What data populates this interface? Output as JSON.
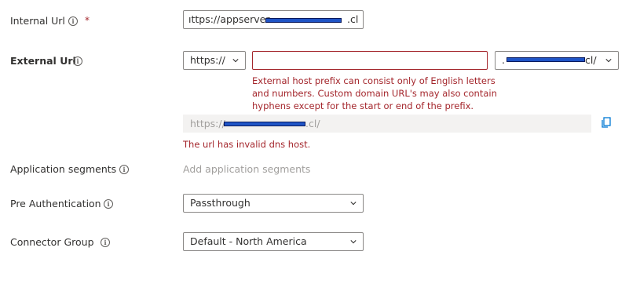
{
  "internal_url": {
    "label": "Internal Url",
    "required_marker": "*",
    "value_prefix": "ıttps://appserver",
    "value_suffix": ".cl"
  },
  "external_url": {
    "label": "External Url",
    "scheme": "https://",
    "prefix_value": "",
    "domain_prefix": ".",
    "domain_suffix": "cl/",
    "prefix_error_lines": [
      "External host prefix can consist only of English letters",
      "and numbers. Custom domain URL's may also contain",
      "hyphens except for the start or end of the prefix."
    ],
    "full_url_prefix": "https://",
    "full_url_suffix": ".cl/",
    "dns_error": "The url has invalid dns host."
  },
  "application_segments": {
    "label": "Application segments",
    "placeholder": "Add application segments"
  },
  "pre_authentication": {
    "label": "Pre Authentication",
    "value": "Passthrough"
  },
  "connector_group": {
    "label": "Connector Group",
    "value": "Default - North America"
  },
  "icons": {
    "info": "info-icon",
    "chevron": "chevron-down-icon",
    "copy": "copy-icon"
  },
  "colors": {
    "error": "#a4262c",
    "redaction": "#1f54c6",
    "accent": "#0078d4"
  }
}
